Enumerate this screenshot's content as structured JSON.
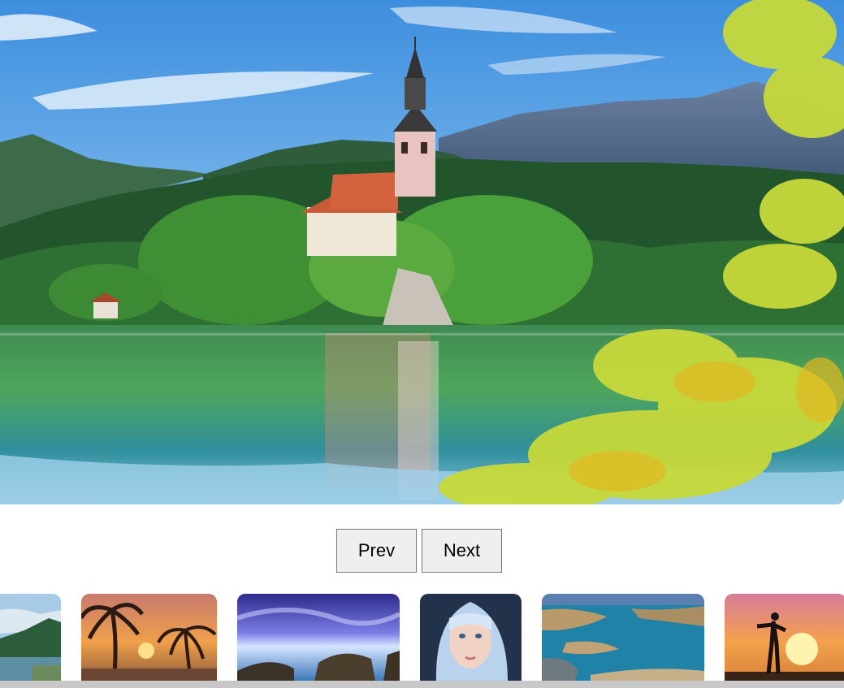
{
  "gallery": {
    "main_image": {
      "subject": "lake-island-church-landscape"
    },
    "controls": {
      "prev_label": "Prev",
      "next_label": "Next"
    },
    "thumbnails": [
      {
        "subject": "forest-lake"
      },
      {
        "subject": "palm-sunset-beach"
      },
      {
        "subject": "purple-sky-rocky-sea"
      },
      {
        "subject": "girl-portrait"
      },
      {
        "subject": "aerial-islands"
      },
      {
        "subject": "silhouette-sunset"
      }
    ]
  },
  "colors": {
    "button_bg": "#efefef",
    "button_border": "#767676",
    "scrollbar": "#c8c8c8"
  }
}
